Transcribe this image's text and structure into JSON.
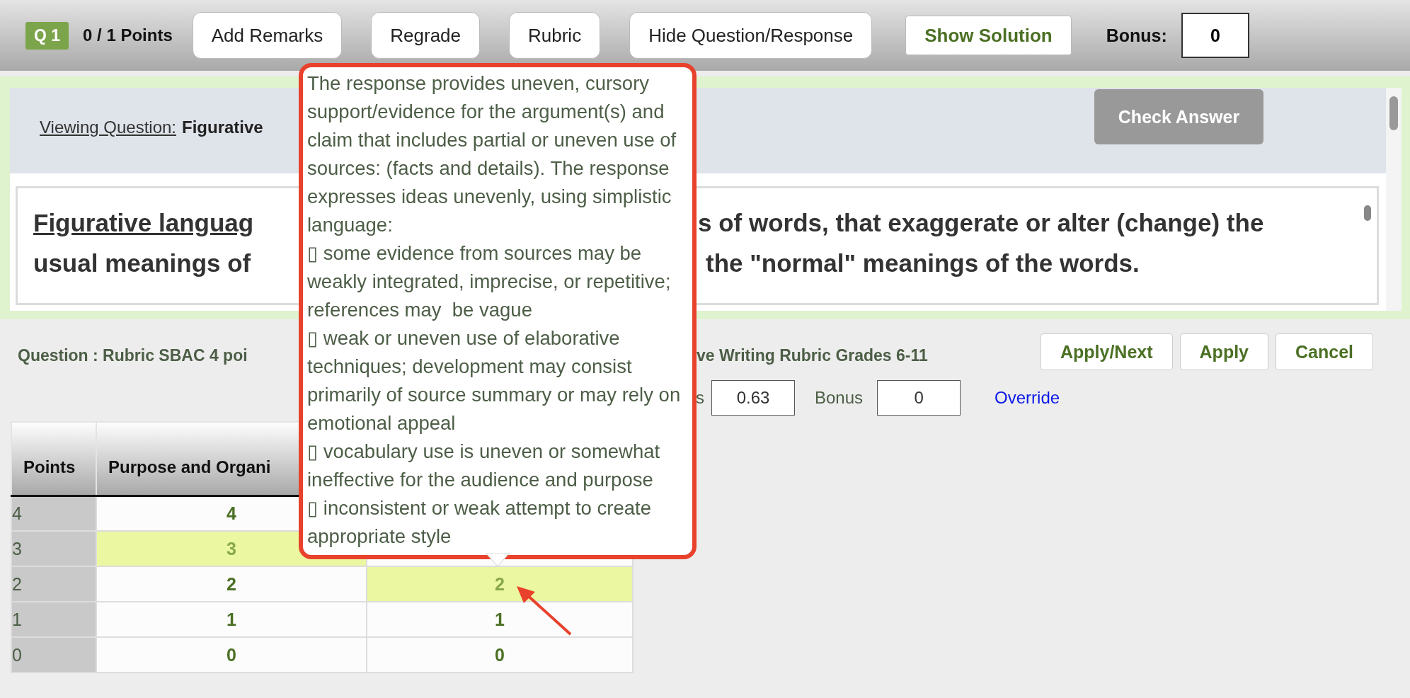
{
  "toolbar": {
    "question_badge": "Q 1",
    "points": "0 / 1 Points",
    "buttons": [
      {
        "label": "Add Remarks",
        "kind": "plain"
      },
      {
        "label": "Regrade",
        "kind": "plain"
      },
      {
        "label": "Rubric",
        "kind": "plain"
      },
      {
        "label": "Hide Question/Response",
        "kind": "plain"
      },
      {
        "label": "Show Solution",
        "kind": "primary"
      }
    ],
    "bonus_label": "Bonus:",
    "bonus_value": "0"
  },
  "question_panel": {
    "viewing_label": "Viewing Question:",
    "viewing_title_visible": "Figurative",
    "check_answer": "Check Answer",
    "text_lines": [
      {
        "left": "Figurative languag",
        "right": "s of words, that exaggerate or alter (change) the"
      },
      {
        "left": "usual meanings of",
        "right": "the \"normal\" meanings of the words."
      }
    ]
  },
  "grading": {
    "question_left": "Question : Rubric SBAC 4 poi",
    "question_right": "ve Writing Rubric Grades 6-11",
    "buttons": [
      "Apply/Next",
      "Apply",
      "Cancel"
    ],
    "score_label_visible": "s",
    "score_value": "0.63",
    "bonus_label": "Bonus",
    "bonus_value": "0",
    "override_link": "Override"
  },
  "rubric_table": {
    "columns": [
      "Points",
      "Purpose and Organi"
    ],
    "rows": [
      {
        "cells": [
          {
            "kind": "points",
            "text": "4"
          },
          {
            "kind": "score",
            "text": "4",
            "selected": false
          }
        ]
      },
      {
        "cells": [
          {
            "kind": "points",
            "text": "3"
          },
          {
            "kind": "score",
            "text": "3",
            "selected": true
          }
        ]
      },
      {
        "cells": [
          {
            "kind": "points",
            "text": "2"
          },
          {
            "kind": "score",
            "text": "2",
            "selected": false
          },
          {
            "kind": "score",
            "text": "2",
            "selected": true
          }
        ]
      },
      {
        "cells": [
          {
            "kind": "points",
            "text": "1"
          },
          {
            "kind": "score",
            "text": "1",
            "selected": false
          },
          {
            "kind": "score",
            "text": "1",
            "selected": false
          }
        ]
      },
      {
        "cells": [
          {
            "kind": "points",
            "text": "0"
          },
          {
            "kind": "score",
            "text": "0",
            "selected": false
          },
          {
            "kind": "score",
            "text": "0",
            "selected": false
          }
        ]
      }
    ]
  },
  "tooltip": {
    "paragraphs": [
      "The response provides uneven, cursory support/evidence for the argument(s) and claim that includes partial or uneven use of sources: (facts and details). The response expresses ideas unevenly, using simplistic language:",
      "▯ some evidence from sources may be weakly integrated, imprecise, or repetitive; references may  be vague",
      "▯ weak or uneven use of elaborative techniques; development may consist primarily of source summary or may rely on emotional appeal",
      "▯ vocabulary use is uneven or somewhat ineffective for the audience and purpose",
      "▯ inconsistent or weak attempt to create appropriate style"
    ]
  }
}
